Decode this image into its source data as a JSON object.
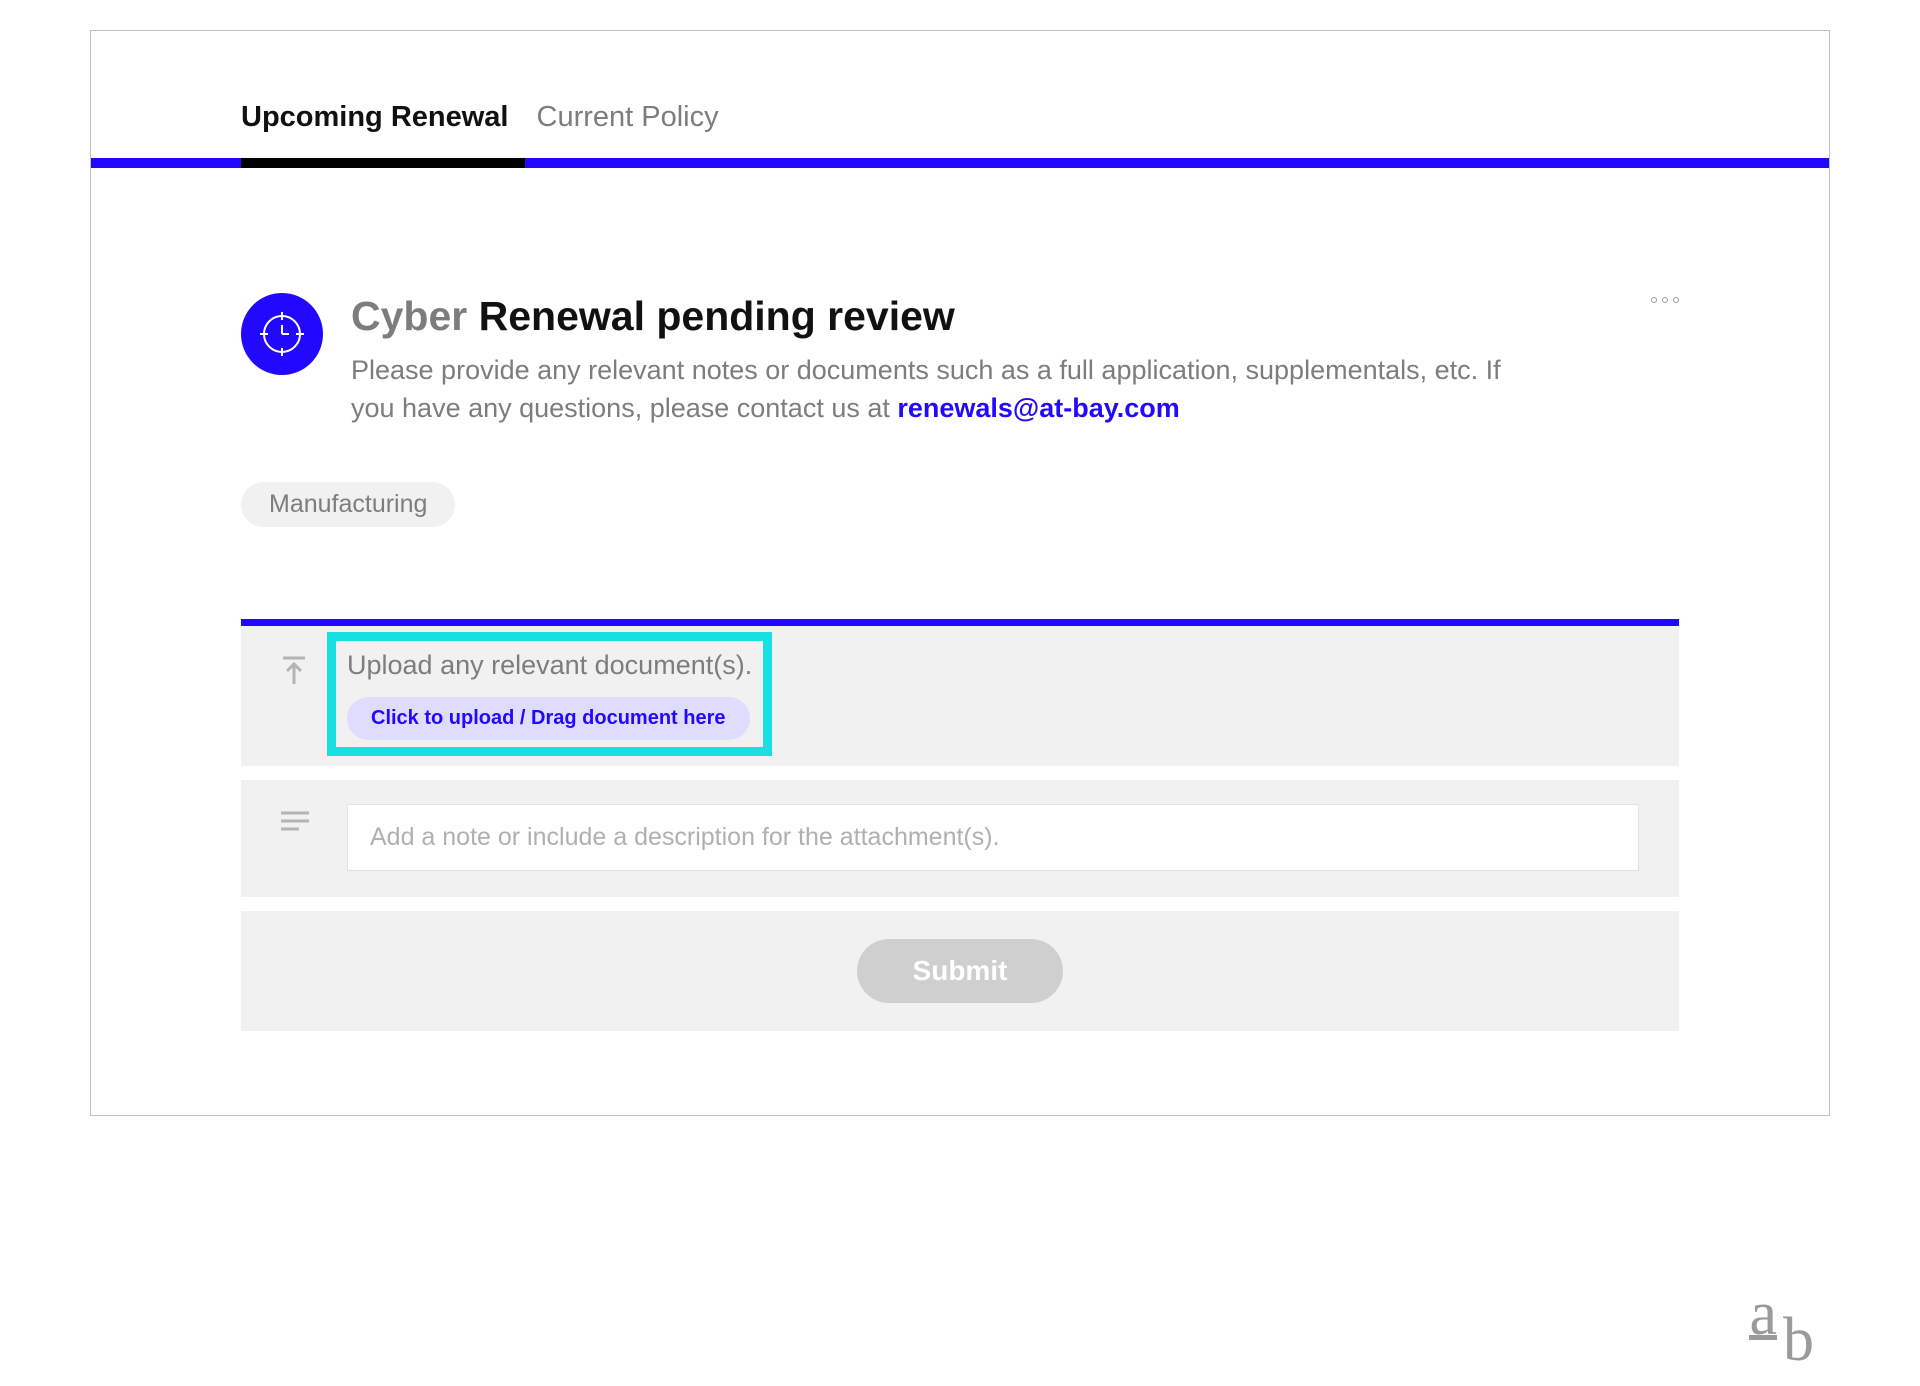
{
  "tabs": {
    "upcoming": "Upcoming Renewal",
    "current": "Current Policy"
  },
  "header": {
    "product": "Cyber",
    "status": "Renewal pending review",
    "subtitle_pre": "Please provide any relevant notes or documents such as a full application, supplementals, etc. If you have any questions, please contact us at ",
    "contact_email": "renewals@at-bay.com"
  },
  "tags": [
    "Manufacturing"
  ],
  "upload": {
    "label": "Upload any relevant document(s).",
    "pill": "Click to upload / Drag document here"
  },
  "note": {
    "placeholder": "Add a note or include a description for the attachment(s)."
  },
  "actions": {
    "submit": "Submit"
  },
  "brand": {
    "a": "a",
    "b": "b"
  },
  "colors": {
    "accent": "#2308ff",
    "highlight": "#18e0e0"
  }
}
